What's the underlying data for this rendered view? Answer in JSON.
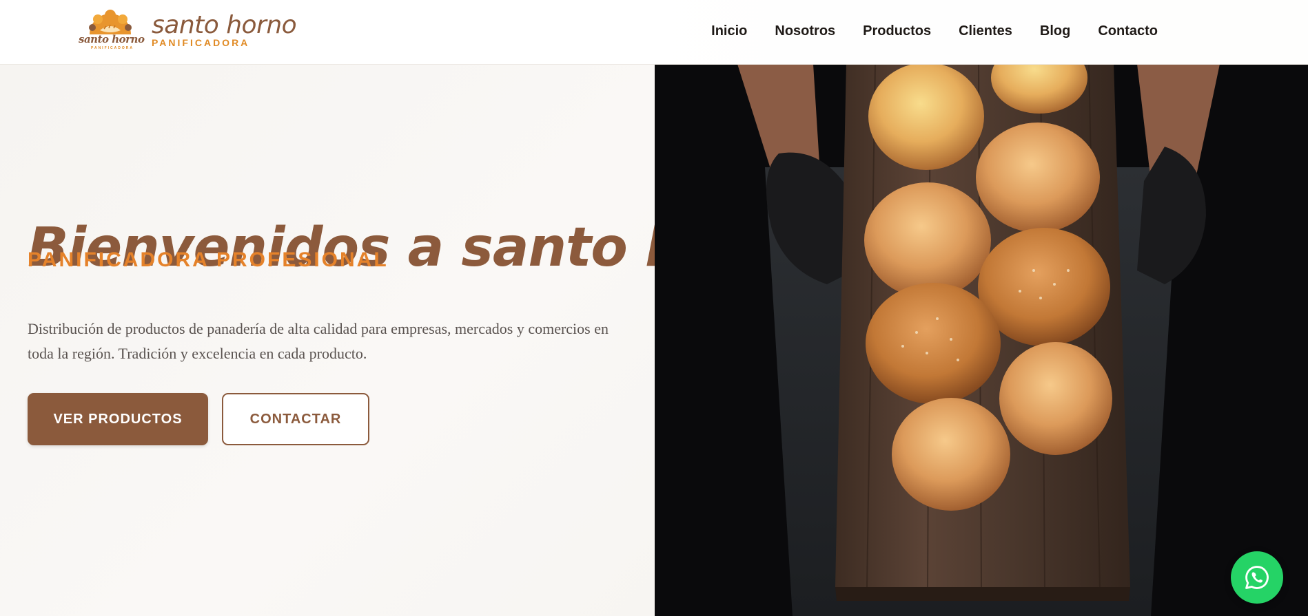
{
  "brand": {
    "mark_text": "santo horno",
    "mark_sub": "PANIFICADORA",
    "name": "santo horno",
    "tagline": "PANIFICADORA",
    "colors": {
      "brown": "#8b5a3c",
      "orange": "#e5822a",
      "whatsapp": "#25d366"
    }
  },
  "nav": {
    "items": [
      {
        "label": "Inicio"
      },
      {
        "label": "Nosotros"
      },
      {
        "label": "Productos"
      },
      {
        "label": "Clientes"
      },
      {
        "label": "Blog"
      },
      {
        "label": "Contacto"
      }
    ]
  },
  "hero": {
    "title": "Bienvenidos a santo horno",
    "subtitle": "PANIFICADORA PROFESIONAL",
    "description": "Distribución de productos de panadería de alta calidad para empresas, mercados y comercios en toda la región. Tradición y excelencia en cada producto.",
    "primary_button": "VER PRODUCTOS",
    "secondary_button": "CONTACTAR"
  },
  "floating": {
    "icon": "whatsapp-icon"
  }
}
